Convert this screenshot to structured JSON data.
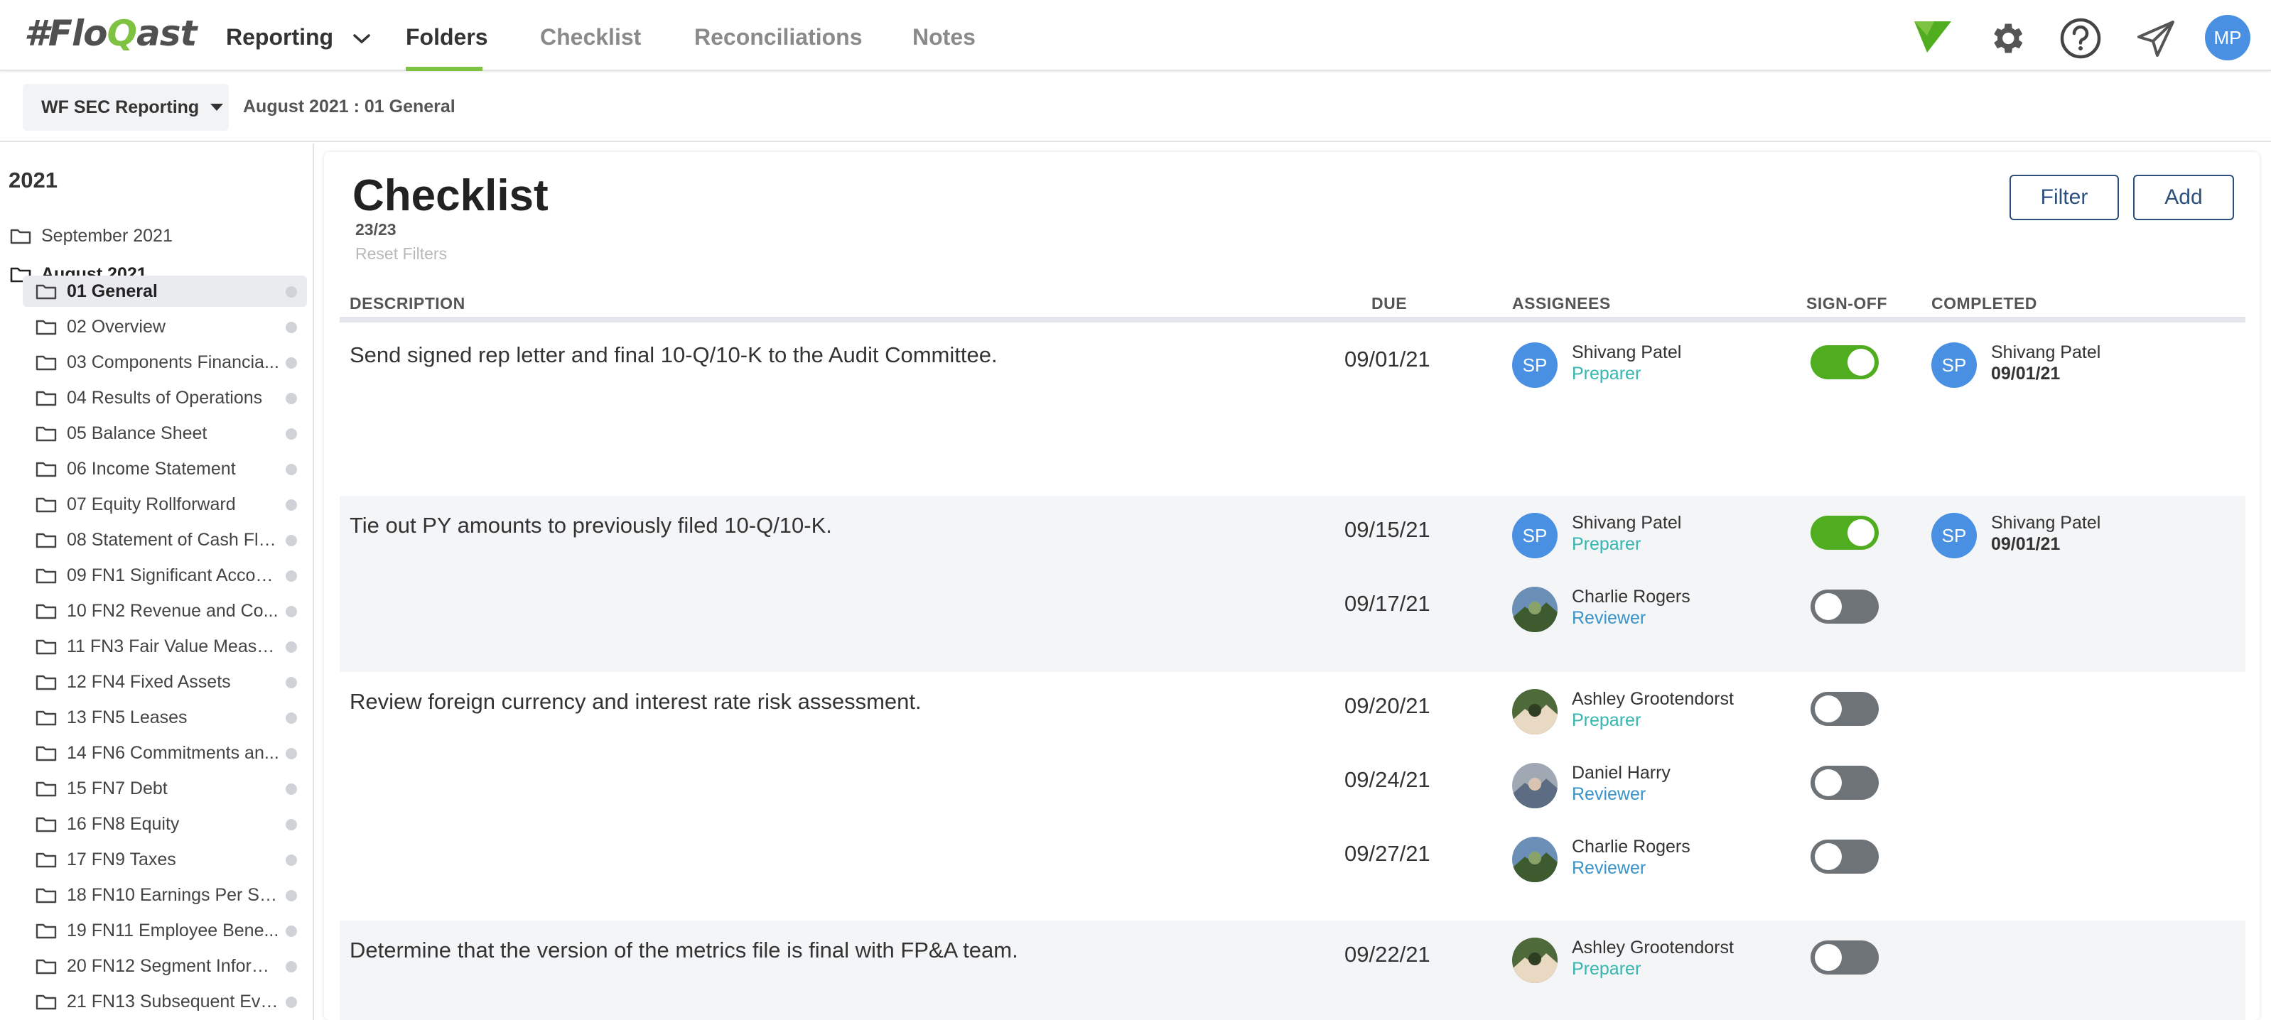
{
  "app": {
    "logo": "#FloQast",
    "logo_q": "Q"
  },
  "nav": {
    "reporting": "Reporting",
    "folders": "Folders",
    "checklist": "Checklist",
    "reconciliations": "Reconciliations",
    "notes": "Notes",
    "user_initials": "MP"
  },
  "subbar": {
    "workspace": "WF SEC Reporting",
    "breadcrumb": "August 2021 : 01 General"
  },
  "sidebar": {
    "year": "2021",
    "top_folders": [
      "September 2021",
      "August 2021"
    ],
    "items": [
      "01 General",
      "02 Overview",
      "03 Components Financia...",
      "04 Results of Operations",
      "05 Balance Sheet",
      "06 Income Statement",
      "07 Equity Rollforward",
      "08 Statement of Cash Flo...",
      "09 FN1 Significant Accou...",
      "10 FN2 Revenue and Co...",
      "11 FN3 Fair Value Measu...",
      "12 FN4 Fixed Assets",
      "13 FN5 Leases",
      "14 FN6 Commitments an...",
      "15 FN7 Debt",
      "16 FN8 Equity",
      "17 FN9 Taxes",
      "18 FN10 Earnings Per Sh...",
      "19 FN11 Employee Bene...",
      "20 FN12 Segment Inform...",
      "21 FN13 Subsequent Eve..."
    ]
  },
  "main": {
    "title": "Checklist",
    "count": "23/23",
    "reset_filters": "Reset Filters",
    "filter_button": "Filter",
    "add_button": "Add",
    "columns": {
      "description": "DESCRIPTION",
      "due": "DUE",
      "assignees": "ASSIGNEES",
      "signoff": "SIGN-OFF",
      "completed": "COMPLETED"
    },
    "rows": [
      {
        "description": "Send signed rep letter and final 10-Q/10-K to the Audit Committee.",
        "assignees": [
          {
            "due": "09/01/21",
            "name": "Shivang Patel",
            "role": "Preparer",
            "initials": "SP",
            "signed": true,
            "completed_name": "Shivang Patel",
            "completed_date": "09/01/21"
          }
        ]
      },
      {
        "description": "Tie out PY amounts to previously filed 10-Q/10-K.",
        "assignees": [
          {
            "due": "09/15/21",
            "name": "Shivang Patel",
            "role": "Preparer",
            "initials": "SP",
            "signed": true,
            "completed_name": "Shivang Patel",
            "completed_date": "09/01/21"
          },
          {
            "due": "09/17/21",
            "name": "Charlie Rogers",
            "role": "Reviewer",
            "signed": false
          }
        ]
      },
      {
        "description": "Review foreign currency and interest rate risk assessment.",
        "assignees": [
          {
            "due": "09/20/21",
            "name": "Ashley Grootendorst",
            "role": "Preparer",
            "signed": false
          },
          {
            "due": "09/24/21",
            "name": "Daniel Harry",
            "role": "Reviewer",
            "signed": false
          },
          {
            "due": "09/27/21",
            "name": "Charlie Rogers",
            "role": "Reviewer",
            "signed": false
          }
        ]
      },
      {
        "description": "Determine that the version of the metrics file is final with FP&A team.",
        "assignees": [
          {
            "due": "09/22/21",
            "name": "Ashley Grootendorst",
            "role": "Preparer",
            "signed": false
          }
        ]
      }
    ]
  },
  "colors": {
    "accent_green": "#7ec242",
    "toggle_on": "#4fad1f",
    "toggle_off": "#6e7378",
    "button_border": "#2d4f7c",
    "preparer": "#37b5b0",
    "reviewer": "#3a93c9",
    "avatar_blue": "#4a90e2"
  }
}
